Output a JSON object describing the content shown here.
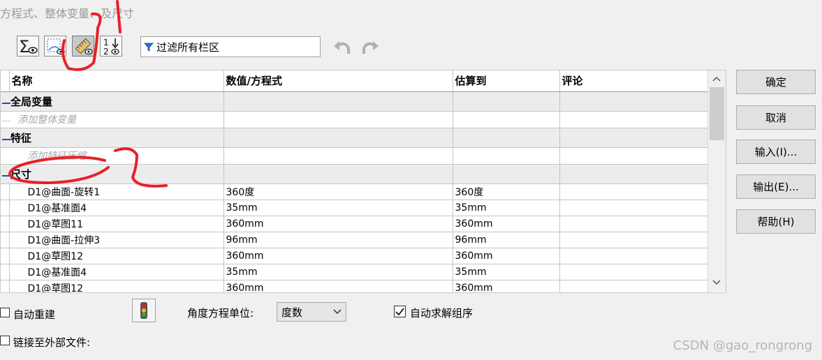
{
  "window": {
    "title": "方程式、整体变量、及尺寸"
  },
  "toolbar": {
    "buttons": [
      {
        "icon": "sigma-eye-icon"
      },
      {
        "icon": "sketch-eye-icon"
      },
      {
        "icon": "dimension-eye-icon",
        "pressed": true
      },
      {
        "icon": "ordered-view-icon",
        "label": "1 2"
      }
    ],
    "filter_placeholder": "过滤所有栏区",
    "undo_icon": "undo-icon",
    "redo_icon": "redo-icon"
  },
  "table": {
    "columns": [
      "名称",
      "数值/方程式",
      "估算到",
      "评论"
    ],
    "groups": {
      "global": {
        "label": "全局变量",
        "add": "添加整体变量"
      },
      "feature": {
        "label": "特征",
        "add": "添加特征压缩"
      },
      "dimension": {
        "label": "尺寸"
      }
    },
    "rows": [
      {
        "name": "D1@曲面-旋转1",
        "value": "360度",
        "evaluated": "360度",
        "comment": ""
      },
      {
        "name": "D1@基准面4",
        "value": "35mm",
        "evaluated": "35mm",
        "comment": ""
      },
      {
        "name": "D1@草图11",
        "value": "360mm",
        "evaluated": "360mm",
        "comment": ""
      },
      {
        "name": "D1@曲面-拉伸3",
        "value": "96mm",
        "evaluated": "96mm",
        "comment": ""
      },
      {
        "name": "D1@草图12",
        "value": "360mm",
        "evaluated": "360mm",
        "comment": ""
      },
      {
        "name": "D1@基准面4",
        "value": "35mm",
        "evaluated": "35mm",
        "comment": ""
      },
      {
        "name": "D1@草图12",
        "value": "360mm",
        "evaluated": "360mm",
        "comment": ""
      }
    ]
  },
  "buttons": {
    "ok": "确定",
    "cancel": "取消",
    "import": "输入(I)...",
    "export": "输出(E)...",
    "help": "帮助(H)"
  },
  "bottom": {
    "auto_rebuild": "自动重建",
    "auto_rebuild_checked": false,
    "angle_unit_label": "角度方程单位:",
    "angle_unit_value": "度数",
    "auto_solve": "自动求解组序",
    "auto_solve_checked": true,
    "link_external": "链接至外部文件:",
    "link_external_checked": false
  },
  "watermark": "CSDN @gao_rongrong",
  "annotations": {
    "mark1": "1",
    "mark2": "2",
    "color": "#e8202a"
  }
}
